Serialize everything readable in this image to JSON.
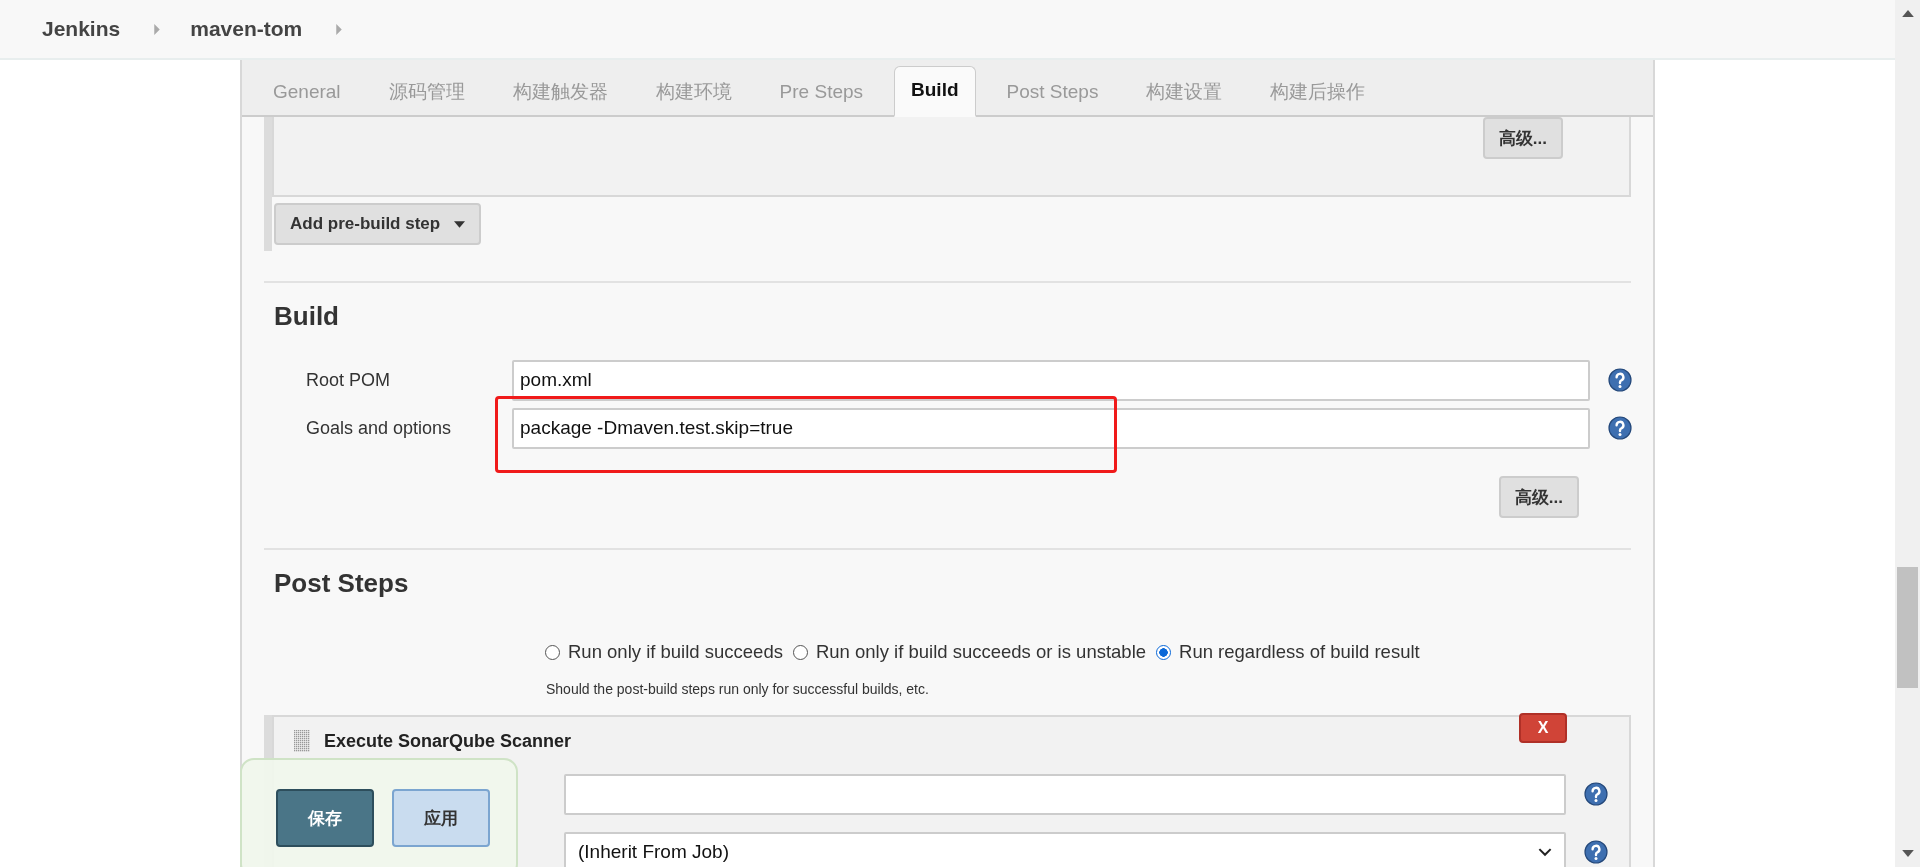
{
  "breadcrumb": [
    {
      "label": "Jenkins"
    },
    {
      "label": "maven-tom"
    }
  ],
  "tabs": [
    {
      "label": "General",
      "selected": false
    },
    {
      "label": "源码管理",
      "selected": false
    },
    {
      "label": "构建触发器",
      "selected": false
    },
    {
      "label": "构建环境",
      "selected": false
    },
    {
      "label": "Pre Steps",
      "selected": false
    },
    {
      "label": "Build",
      "selected": true
    },
    {
      "label": "Post Steps",
      "selected": false
    },
    {
      "label": "构建设置",
      "selected": false
    },
    {
      "label": "构建后操作",
      "selected": false
    }
  ],
  "pre_steps": {
    "advanced_button": "高级...",
    "add_button": "Add pre-build step"
  },
  "build": {
    "title": "Build",
    "fields": [
      {
        "label": "Root POM",
        "value": "pom.xml",
        "highlighted": false
      },
      {
        "label": "Goals and options",
        "value": "package -Dmaven.test.skip=true",
        "highlighted": true
      }
    ],
    "advanced_button": "高级..."
  },
  "post_steps": {
    "title": "Post Steps",
    "options": [
      {
        "label": "Run only if build succeeds",
        "selected": false
      },
      {
        "label": "Run only if build succeeds or is unstable",
        "selected": false
      },
      {
        "label": "Run regardless of build result",
        "selected": true
      }
    ],
    "hint": "Should the post-build steps run only for successful builds, etc.",
    "step": {
      "title": "Execute SonarQube Scanner",
      "delete_button": "X",
      "fields": [
        {
          "kind": "text"
        },
        {
          "kind": "select",
          "value": "(Inherit From Job)"
        }
      ]
    }
  },
  "save_bar": {
    "buttons": [
      {
        "label": "保存",
        "kind": "primary"
      },
      {
        "label": "应用",
        "kind": "secondary"
      }
    ]
  }
}
